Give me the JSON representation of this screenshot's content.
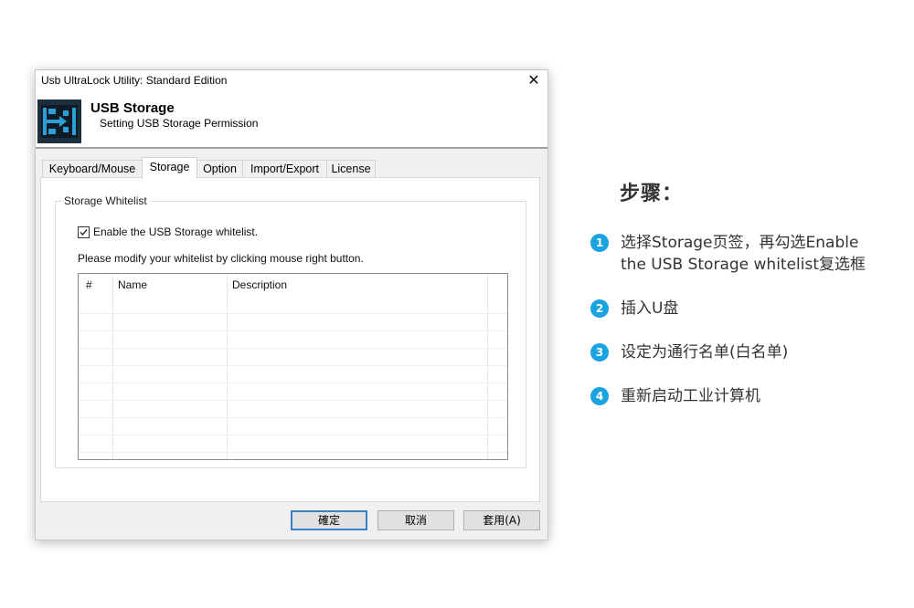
{
  "window": {
    "title": "Usb UltraLock Utility: Standard Edition",
    "close_glyph": "✕"
  },
  "header": {
    "title": "USB Storage",
    "subtitle": "Setting USB Storage Permission",
    "icon": "usb-storage-icon"
  },
  "tabs": [
    {
      "label": "Keyboard/Mouse",
      "active": false
    },
    {
      "label": "Storage",
      "active": true
    },
    {
      "label": "Option",
      "active": false
    },
    {
      "label": "Import/Export",
      "active": false
    },
    {
      "label": "License",
      "active": false
    }
  ],
  "storage": {
    "group_label": "Storage Whitelist",
    "checkbox_label": "Enable the USB Storage whitelist.",
    "checkbox_checked": true,
    "hint": "Please modify your whitelist by clicking mouse right button.",
    "columns": [
      "#",
      "Name",
      "Description"
    ],
    "rows": []
  },
  "buttons": {
    "ok": "確定",
    "cancel": "取消",
    "apply": "套用(A)"
  },
  "steps": {
    "title": "步骤：",
    "items": [
      {
        "num": "1",
        "line1": "选择Storage页签，再勾选Enable",
        "line2": "the USB Storage whitelist复选框"
      },
      {
        "num": "2",
        "line1": "插入U盘"
      },
      {
        "num": "3",
        "line1": "设定为通行名单(白名单)"
      },
      {
        "num": "4",
        "line1": "重新启动工业计算机"
      }
    ]
  },
  "colors": {
    "accent": "#1aa3e0",
    "default_button_border": "#3c7ec8",
    "icon_blue": "#2a9fd8"
  }
}
